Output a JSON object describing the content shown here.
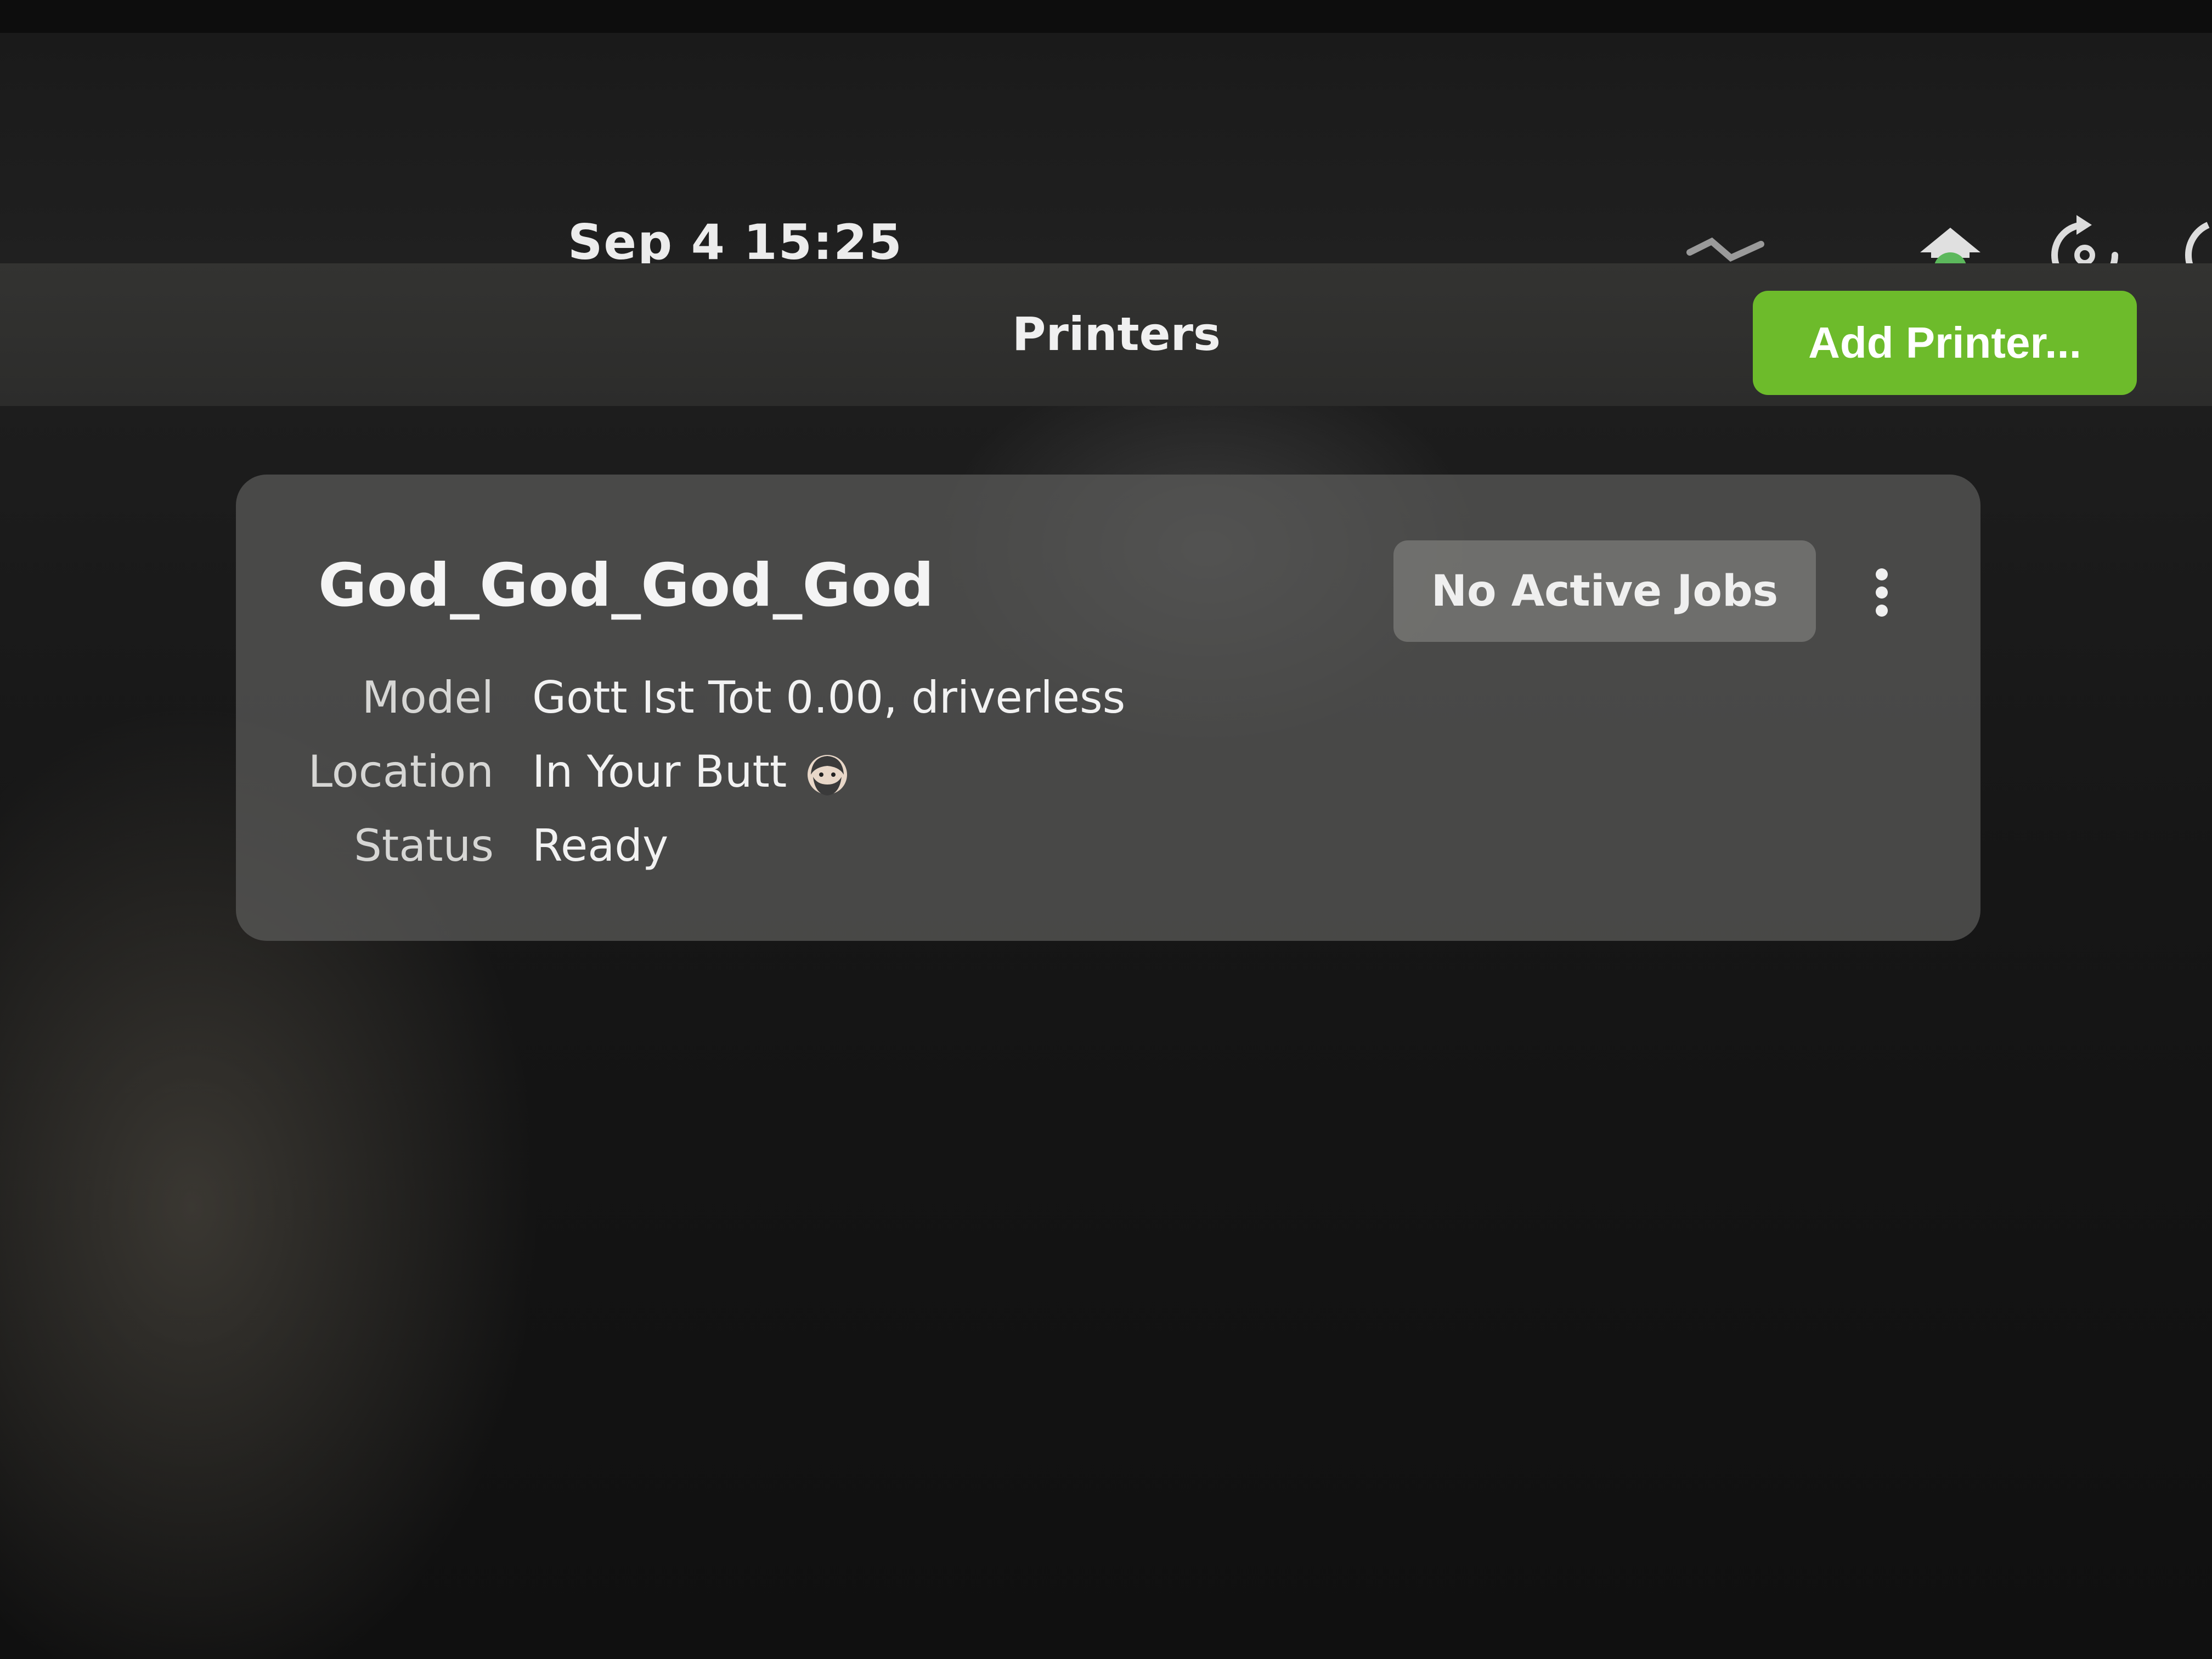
{
  "topbar": {
    "clock": "Sep 4  15:25",
    "icons": [
      "network-icon",
      "update-notifier-icon",
      "screen-rotation-icon",
      "power-icon"
    ]
  },
  "header": {
    "title": "Printers",
    "add_button_label": "Add Printer..."
  },
  "printer": {
    "name": "God_God_God_God",
    "jobs_button_label": "No Active Jobs",
    "details": {
      "model_label": "Model",
      "model_value": "Gott Ist Tot 0.00, driverless",
      "location_label": "Location",
      "location_value": "In Your Butt",
      "status_label": "Status",
      "status_value": "Ready"
    }
  },
  "colors": {
    "accent": "#6dbb2b",
    "update_icon": "#5cb85c",
    "card_bg": "#5c5c5a",
    "text": "#f2f2f2"
  }
}
